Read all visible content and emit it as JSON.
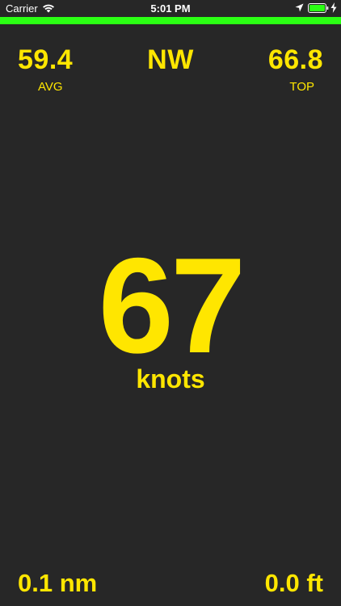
{
  "status_bar": {
    "carrier": "Carrier",
    "time": "5:01 PM"
  },
  "colors": {
    "background": "#272727",
    "accent": "#ffe600",
    "signal_bar": "#2bff14"
  },
  "stats": {
    "avg_value": "59.4",
    "avg_label": "AVG",
    "direction": "NW",
    "top_value": "66.8",
    "top_label": "TOP"
  },
  "speed": {
    "value": "67",
    "unit": "knots"
  },
  "bottom": {
    "distance": "0.1 nm",
    "altitude": "0.0 ft"
  },
  "icons": [
    "wifi-icon",
    "location-arrow-icon",
    "battery-icon",
    "charging-bolt-icon"
  ]
}
